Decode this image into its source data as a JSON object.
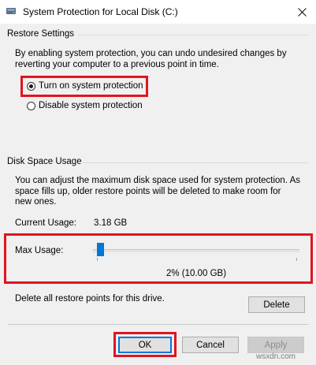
{
  "window": {
    "title": "System Protection for Local Disk (C:)",
    "close_glyph": "close-icon"
  },
  "restore_settings": {
    "group_label": "Restore Settings",
    "description_lines": [
      "By enabling system protection, you can undo undesired changes by",
      "reverting your computer to a previous point in time."
    ],
    "options": [
      {
        "label": "Turn on system protection",
        "checked": true
      },
      {
        "label": "Disable system protection",
        "checked": false
      }
    ]
  },
  "disk_space": {
    "group_label": "Disk Space Usage",
    "description_lines": [
      "You can adjust the maximum disk space used for system protection. As",
      "space fills up, older restore points will be deleted to make room for",
      "new ones."
    ],
    "current_usage_label": "Current Usage:",
    "current_usage_value": "3.18 GB",
    "max_usage_label": "Max Usage:",
    "max_usage_percent": 2,
    "max_usage_readout": "2% (10.00 GB)"
  },
  "delete_section": {
    "text": "Delete all restore points for this drive.",
    "button_label": "Delete"
  },
  "footer": {
    "ok_label": "OK",
    "cancel_label": "Cancel",
    "apply_label": "Apply"
  },
  "watermark": "wsxdn.com",
  "colors": {
    "highlight": "#e0151f",
    "accent": "#0078d7",
    "window_bg": "#f0f0f0"
  }
}
